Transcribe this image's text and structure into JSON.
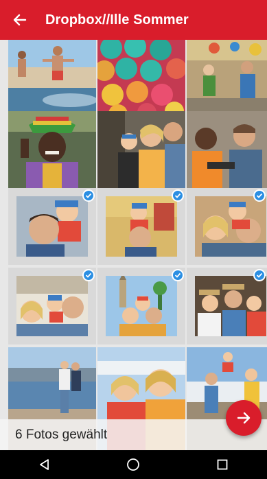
{
  "app_bar": {
    "title": "Dropbox//Ille Sommer",
    "back_icon": "arrow-left-icon",
    "color": "#d91d2b"
  },
  "photos": [
    {
      "selected": false
    },
    {
      "selected": false
    },
    {
      "selected": false
    },
    {
      "selected": false
    },
    {
      "selected": false
    },
    {
      "selected": false
    },
    {
      "selected": true
    },
    {
      "selected": true
    },
    {
      "selected": true
    },
    {
      "selected": true
    },
    {
      "selected": true
    },
    {
      "selected": true
    },
    {
      "selected": false
    },
    {
      "selected": false
    },
    {
      "selected": false
    }
  ],
  "selection": {
    "label": "6 Fotos gewählt",
    "fab_icon": "arrow-right-icon"
  },
  "nav_bar": {
    "back_icon": "triangle-back-icon",
    "home_icon": "circle-home-icon",
    "recents_icon": "square-recents-icon"
  },
  "colors": {
    "accent": "#d91d2b",
    "check": "#2b8fe3"
  }
}
